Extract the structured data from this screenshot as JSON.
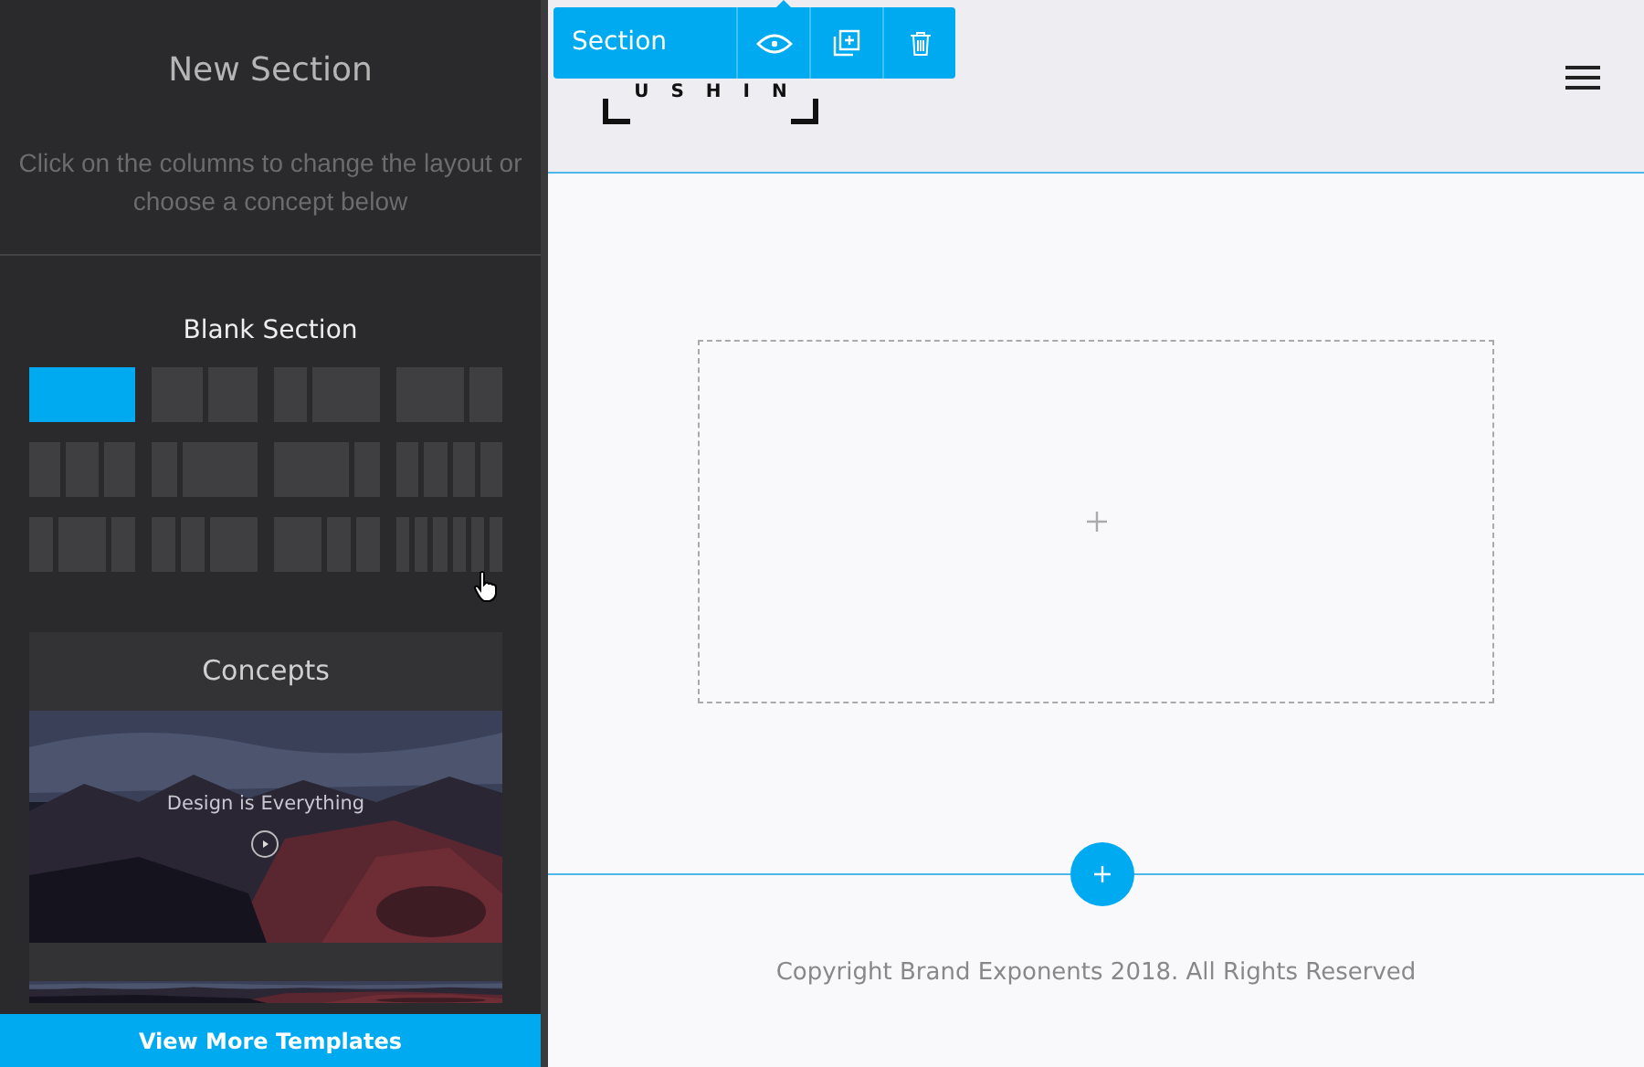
{
  "sidebar": {
    "title": "New Section",
    "hint": "Click on the columns to change the layout or choose a concept below",
    "blank_section": {
      "title": "Blank Section",
      "layouts": [
        {
          "kind": "full",
          "selected": true
        },
        {
          "kind": "halves",
          "selected": false
        },
        {
          "kind": "third-twothirds",
          "selected": false
        },
        {
          "kind": "twothirds-third",
          "selected": false
        },
        {
          "kind": "thirds",
          "selected": false
        },
        {
          "kind": "quarter-threequarters",
          "selected": false
        },
        {
          "kind": "threequarters-quarter",
          "selected": false
        },
        {
          "kind": "quarters",
          "selected": false
        },
        {
          "kind": "quarter-half-quarter",
          "selected": false
        },
        {
          "kind": "quarter-quarter-half",
          "selected": false
        },
        {
          "kind": "half-quarter-quarter",
          "selected": false
        },
        {
          "kind": "sixths",
          "selected": false
        }
      ]
    },
    "concepts": {
      "title": "Concepts",
      "items": [
        {
          "kind": "picture",
          "caption": "Design is Everything"
        },
        {
          "kind": "picture"
        }
      ]
    },
    "more_button": "View More Templates"
  },
  "toolbar": {
    "label": "Section"
  },
  "header": {
    "logo": "USHIN"
  },
  "footer": {
    "copyright": "Copyright Brand Exponents 2018. All Rights Reserved"
  }
}
